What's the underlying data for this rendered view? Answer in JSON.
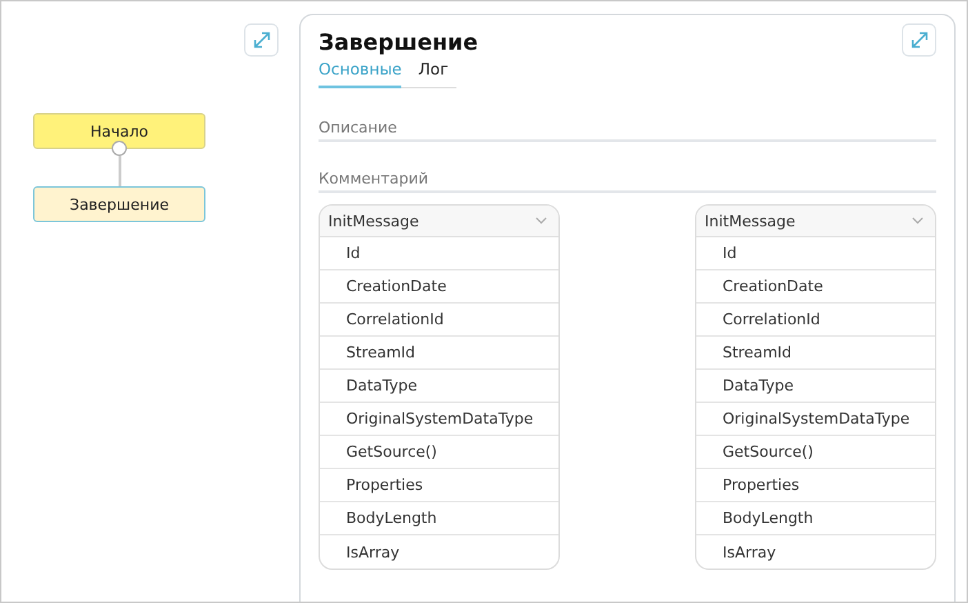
{
  "diagram": {
    "nodes": [
      {
        "label": "Начало",
        "kind": "start"
      },
      {
        "label": "Завершение",
        "kind": "end"
      }
    ]
  },
  "panel": {
    "title": "Завершение",
    "tabs": [
      {
        "label": "Основные",
        "selected": true
      },
      {
        "label": "Лог",
        "selected": false
      }
    ],
    "fields": [
      {
        "placeholder": "Описание"
      },
      {
        "placeholder": "Комментарий"
      }
    ],
    "lists": [
      {
        "header": "InitMessage",
        "items": [
          "Id",
          "CreationDate",
          "CorrelationId",
          "StreamId",
          "DataType",
          "OriginalSystemDataType",
          "GetSource()",
          "Properties",
          "BodyLength",
          "IsArray"
        ]
      },
      {
        "header": "InitMessage",
        "items": [
          "Id",
          "CreationDate",
          "CorrelationId",
          "StreamId",
          "DataType",
          "OriginalSystemDataType",
          "GetSource()",
          "Properties",
          "BodyLength",
          "IsArray"
        ]
      }
    ]
  }
}
